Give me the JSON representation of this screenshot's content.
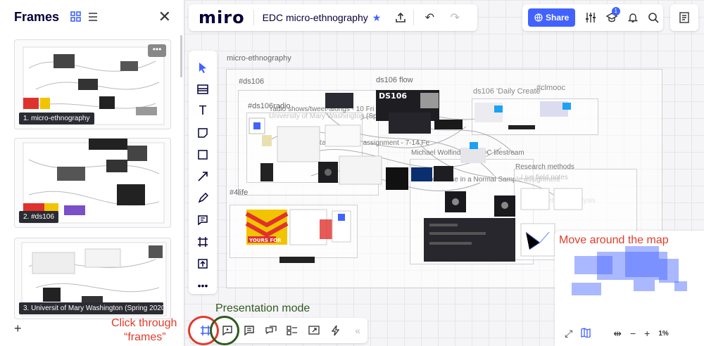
{
  "frames_panel": {
    "title": "Frames",
    "add_label": "+",
    "thumbnails": [
      {
        "label": "1. micro-ethnography"
      },
      {
        "label": "2. #ds106"
      },
      {
        "label": "3. Universit of Mary Washington (Spring 2020"
      }
    ]
  },
  "topbar": {
    "logo": "miro",
    "board_title": "EDC micro-ethnography"
  },
  "topright": {
    "share_label": "Share",
    "badge_count": "1"
  },
  "canvas": {
    "labels": {
      "micro_ethnography": "micro-ethnography",
      "ds106": "#ds106",
      "ds106_flow": "ds106 flow",
      "ds106_daily": "ds106 'Daily Create'",
      "clmooc": "#clmooc",
      "ds106radio": "#ds106radio",
      "radio_shows": "radio shows/tweet-alongs - 10 Fri 20 participants",
      "umw": "University of Mary Washington (Spring 2020 c",
      "radio_bumper": "Radio bumper assignment - 7-14 Fe",
      "michael": "Michael Wolfindale's EDC lifestream",
      "research": "Research methods",
      "live_field": "Live field notes",
      "make_noise": "Make Noise in a Normal Sample assignment",
      "social_network": "Social network analysis",
      "fourlife": "#4life",
      "yours_for": "YOURS FOR",
      "ds106_logo": "DS106"
    }
  },
  "minimap": {
    "zoom": "1%"
  },
  "annotations": {
    "presentation": "Presentation mode",
    "click_through_1": "Click through",
    "click_through_2": "“frames”",
    "move_around": "Move around the map"
  },
  "colors": {
    "accent": "#4262ff",
    "annotation_red": "#e03b2c",
    "annotation_green": "#2f5a1e"
  }
}
